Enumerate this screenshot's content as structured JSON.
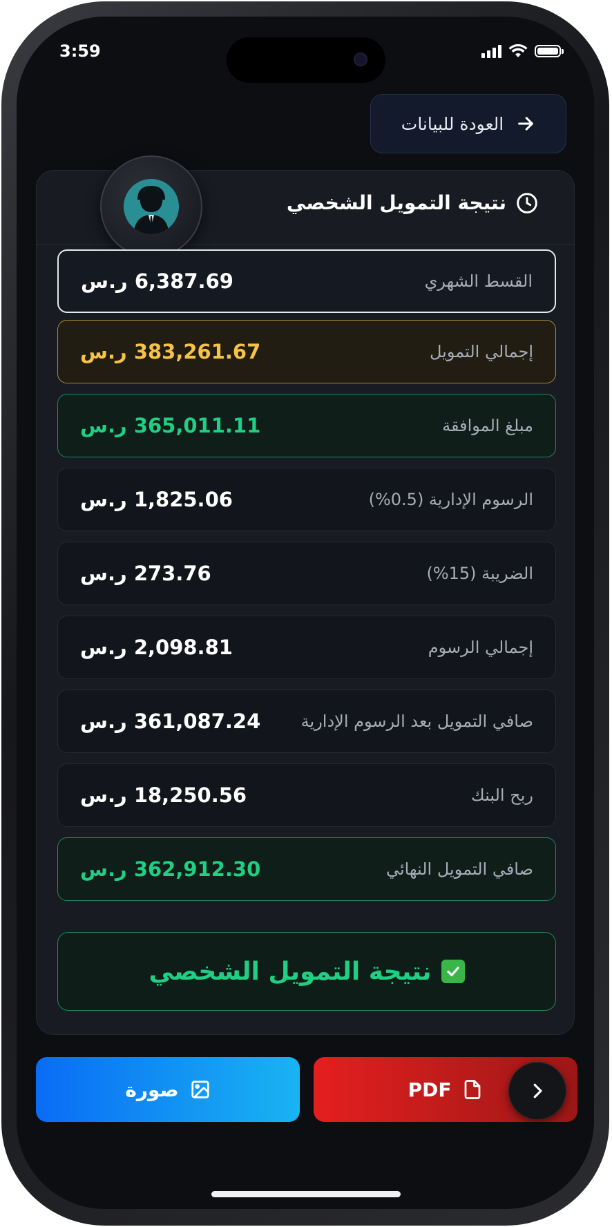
{
  "status_bar": {
    "time": "3:59"
  },
  "header": {
    "back_label": "العودة للبيانات"
  },
  "card": {
    "title": "نتيجة التمويل الشخصي",
    "rows": [
      {
        "label": "القسط الشهري",
        "value": "6,387.69 ر.س"
      },
      {
        "label": "إجمالي التمويل",
        "value": "383,261.67 ر.س"
      },
      {
        "label": "مبلغ الموافقة",
        "value": "365,011.11 ر.س"
      },
      {
        "label": "الرسوم الإدارية (0.5%)",
        "value": "1,825.06 ر.س"
      },
      {
        "label": "الضريبة (15%)",
        "value": "273.76 ر.س"
      },
      {
        "label": "إجمالي الرسوم",
        "value": "2,098.81 ر.س"
      },
      {
        "label": "صافي التمويل بعد الرسوم الإدارية",
        "value": "361,087.24 ر.س"
      },
      {
        "label": "ربح البنك",
        "value": "18,250.56 ر.س"
      },
      {
        "label": "صافي التمويل النهائي",
        "value": "362,912.30 ر.س"
      }
    ],
    "summary_text": "نتيجة التمويل الشخصي"
  },
  "actions": {
    "image_label": "صورة",
    "pdf_label": "PDF"
  },
  "colors": {
    "accent_green": "#1fcf83",
    "accent_yellow": "#f6c344",
    "blue": "#0a6cf5",
    "red": "#e41f1f"
  }
}
